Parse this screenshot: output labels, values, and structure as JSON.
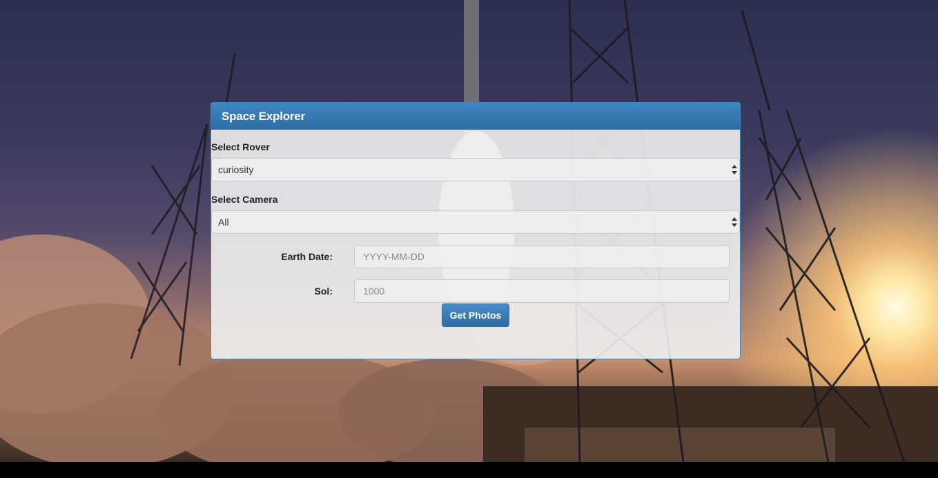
{
  "panel": {
    "title": "Space Explorer"
  },
  "rover": {
    "label": "Select Rover",
    "selected": "curiosity"
  },
  "camera": {
    "label": "Select Camera",
    "selected": "All"
  },
  "earth_date": {
    "label": "Earth Date:",
    "placeholder": "YYYY-MM-DD"
  },
  "sol": {
    "label": "Sol:",
    "placeholder": "1000"
  },
  "actions": {
    "get_photos": "Get Photos"
  },
  "colors": {
    "primary": "#337ab7",
    "panel_background": "#f0f0f0"
  }
}
